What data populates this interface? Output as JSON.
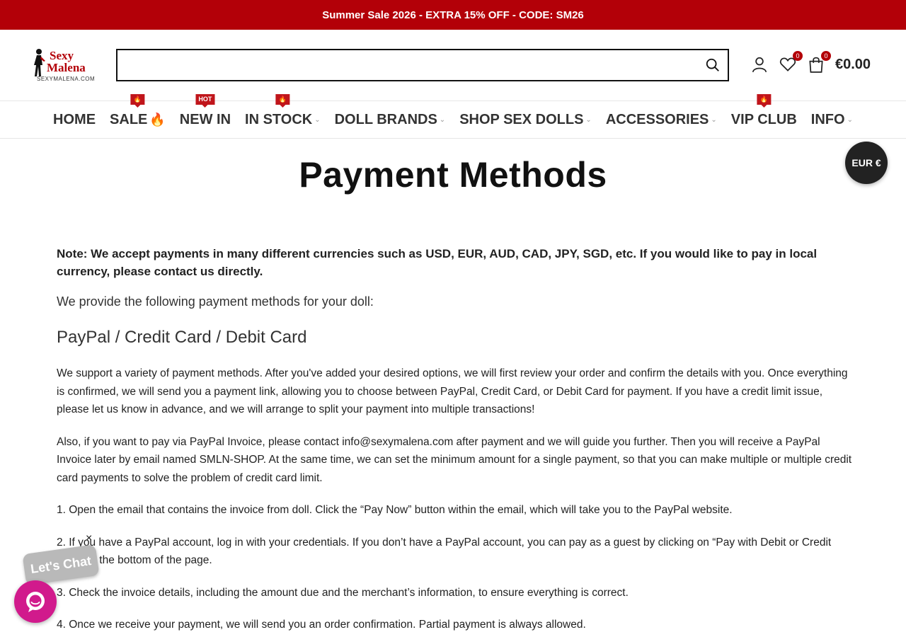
{
  "promo": {
    "text": "Summer Sale 2026 - EXTRA 15% OFF - CODE: SM26"
  },
  "logo": {
    "line1": "Sexy",
    "line2": "Malena",
    "domain": "SEXYMALENA.COM"
  },
  "search": {
    "placeholder": "",
    "value": ""
  },
  "header": {
    "wishlist_count": "0",
    "cart_count": "0",
    "cart_total": "€0.00"
  },
  "nav": {
    "items": [
      {
        "label": "HOME"
      },
      {
        "label": "SALE"
      },
      {
        "label": "NEW IN",
        "flag": "HOT"
      },
      {
        "label": "IN STOCK"
      },
      {
        "label": "DOLL BRANDS"
      },
      {
        "label": "SHOP SEX DOLLS"
      },
      {
        "label": "ACCESSORIES"
      },
      {
        "label": "VIP CLUB"
      },
      {
        "label": "INFO"
      }
    ]
  },
  "currency": {
    "label": "EUR €"
  },
  "page": {
    "title": "Payment Methods",
    "note": "Note: We accept payments in many different currencies such as USD, EUR, AUD, CAD, JPY, SGD, etc. If you would like to pay in local currency, please contact us directly.",
    "intro": "We provide the following payment methods for your doll:",
    "section_heading": "PayPal / Credit Card / Debit Card",
    "paragraphs": [
      "We support a variety of payment methods. After you've added your desired options, we will first review your order and confirm the details with you. Once everything is confirmed, we will send you a payment link, allowing you to choose between PayPal, Credit Card, or Debit Card for payment. If you have a credit limit issue, please let us know in advance, and we will arrange to split your payment into multiple transactions!",
      "Also, if you want to pay via PayPal Invoice, please contact info@sexymalena.com after payment and we will guide you further. Then you will receive a PayPal Invoice later by email named SMLN-SHOP. At the same time, we can set the minimum amount for a single payment, so that you can make multiple or multiple credit card payments to solve the problem of credit card limit.",
      "1. Open the email that contains the invoice from doll. Click the “Pay Now” button within the email, which will take you to the PayPal website.",
      "2. If you have a PayPal account, log in with your credentials. If you don’t have a PayPal account, you can pay as a guest by clicking on “Pay with Debit or Credit Card” at the bottom of the page.",
      "3. Check the invoice details, including the amount due and the merchant’s information, to ensure everything is correct.",
      "4. Once we receive your payment, we will send you an order confirmation. Partial payment is always allowed."
    ]
  },
  "chat": {
    "label": "Let's Chat",
    "close": "×"
  },
  "colors": {
    "brand": "#b30008",
    "chat": "#d11a8c",
    "text": "#222222"
  }
}
